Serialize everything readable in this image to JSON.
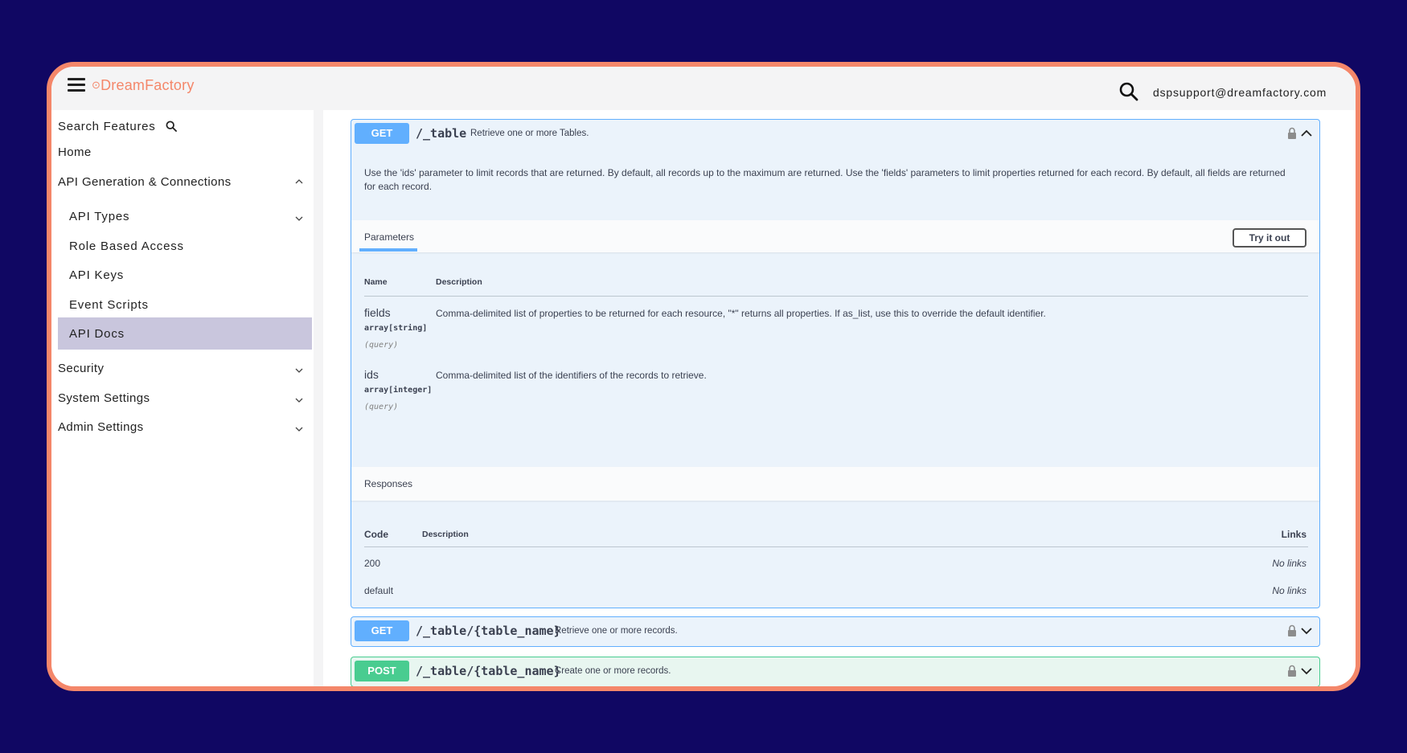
{
  "app": {
    "logo_mark": "⊙",
    "logo_text": "DreamFactory",
    "user_email": "dspsupport@dreamfactory.com"
  },
  "sidebar": {
    "search_label": "Search Features",
    "home": "Home",
    "api_generation": "API Generation & Connections",
    "api_types": "API Types",
    "role_based_access": "Role Based Access",
    "api_keys": "API Keys",
    "event_scripts": "Event Scripts",
    "api_docs": "API Docs",
    "security": "Security",
    "system_settings": "System Settings",
    "admin_settings": "Admin Settings"
  },
  "op1": {
    "method": "GET",
    "path": "/_table",
    "summary": "Retrieve one or more Tables.",
    "description": "Use the 'ids' parameter to limit records that are returned. By default, all records up to the maximum are returned. Use the 'fields' parameters to limit properties returned for each record. By default, all fields are returned for each record.",
    "tab_parameters": "Parameters",
    "try_button": "Try it out",
    "param_headers": {
      "name": "Name",
      "description": "Description"
    },
    "params": [
      {
        "name": "fields",
        "type": "array[string]",
        "in": "(query)",
        "description": "Comma-delimited list of properties to be returned for each resource, \"*\" returns all properties. If as_list, use this to override the default identifier."
      },
      {
        "name": "ids",
        "type": "array[integer]",
        "in": "(query)",
        "description": "Comma-delimited list of the identifiers of the records to retrieve."
      }
    ],
    "responses_label": "Responses",
    "resp_headers": {
      "code": "Code",
      "description": "Description",
      "links": "Links"
    },
    "responses": [
      {
        "code": "200",
        "links": "No links"
      },
      {
        "code": "default",
        "links": "No links"
      }
    ]
  },
  "op2": {
    "method": "GET",
    "path": "/_table/{table_name}",
    "summary": "Retrieve one or more records."
  },
  "op3": {
    "method": "POST",
    "path": "/_table/{table_name}",
    "summary": "Create one or more records."
  },
  "colors": {
    "background": "#100763",
    "frame_border": "#f4876a",
    "get": "#61affe",
    "post": "#49cc90",
    "active_nav": "#c9c6dd"
  },
  "icons": [
    "menu-icon",
    "search-icon",
    "chevron-up-icon",
    "chevron-down-icon",
    "lock-icon"
  ]
}
